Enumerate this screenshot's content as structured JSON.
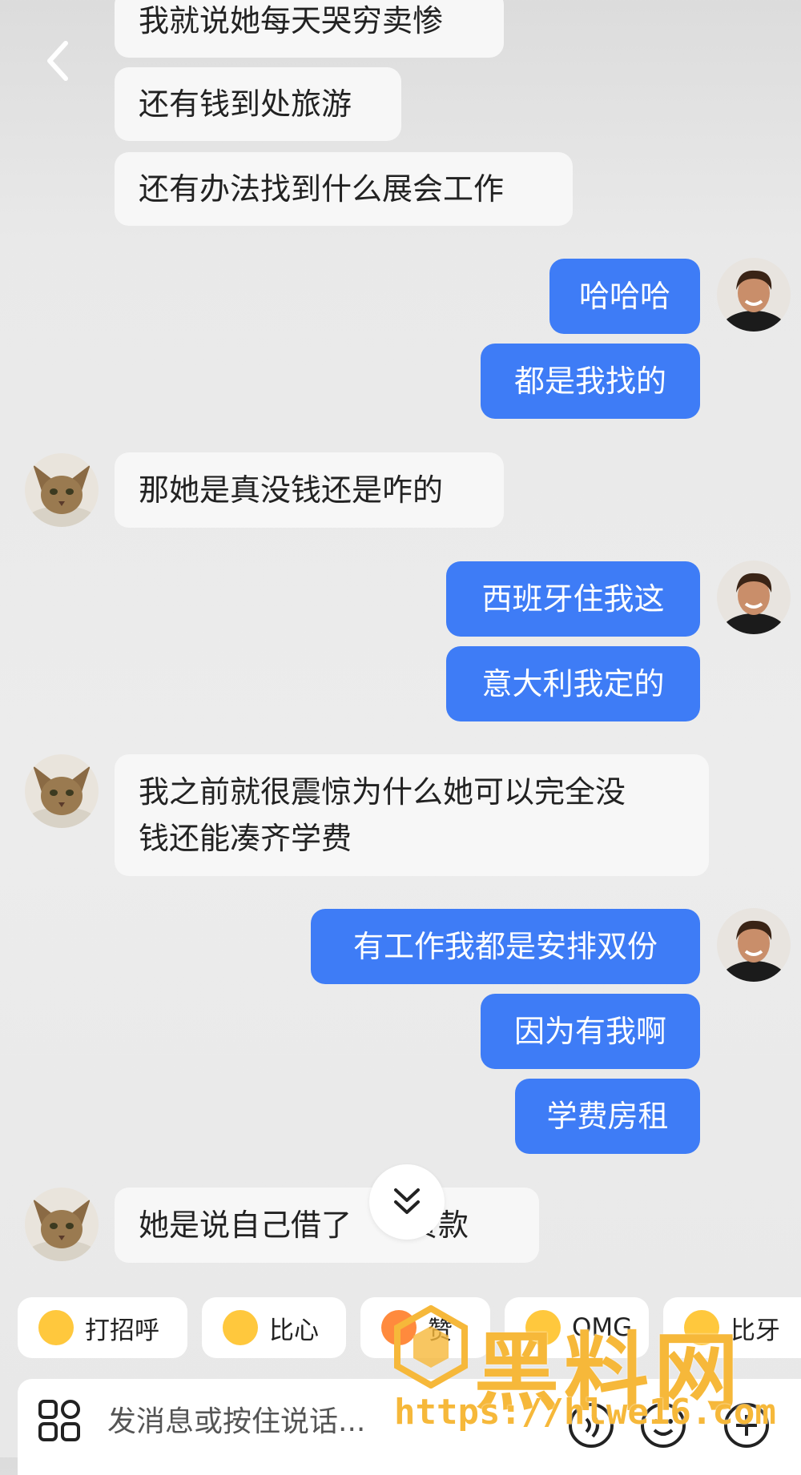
{
  "messages": [
    {
      "side": "left",
      "text": "我就说她每天哭穷卖惨"
    },
    {
      "side": "left",
      "text": "还有钱到处旅游"
    },
    {
      "side": "left",
      "text": "还有办法找到什么展会工作"
    },
    {
      "side": "right",
      "text": "哈哈哈"
    },
    {
      "side": "right",
      "text": "都是我找的"
    },
    {
      "side": "left",
      "text": "那她是真没钱还是咋的"
    },
    {
      "side": "right",
      "text": "西班牙住我这"
    },
    {
      "side": "right",
      "text": "意大利我定的"
    },
    {
      "side": "left",
      "line1": "我之前就很震惊为什么她可以完全没",
      "line2": "钱还能凑齐学费"
    },
    {
      "side": "right",
      "text": "有工作我都是安排双份"
    },
    {
      "side": "right",
      "text": "因为有我啊"
    },
    {
      "side": "right",
      "text": "学费房租"
    },
    {
      "side": "left",
      "text": "她是说自己借了",
      "text_after": "贷款"
    }
  ],
  "quick_replies": [
    {
      "label": "打招呼",
      "icon": "smiling-emoji-icon"
    },
    {
      "label": "比心",
      "icon": "heart-hands-emoji-icon"
    },
    {
      "label": "赞",
      "icon": "thumbs-up-emoji-icon"
    },
    {
      "label": "OMG",
      "icon": "omg-emoji-icon"
    },
    {
      "label": "比牙",
      "icon": "grin-emoji-icon"
    }
  ],
  "input": {
    "placeholder": "发消息或按住说话..."
  },
  "watermark": {
    "title": "黑料网",
    "url": "https://hlwe16.com"
  },
  "colors": {
    "sent_bubble": "#3e7cf6",
    "received_bubble": "#f7f7f7",
    "watermark": "#f6b83a"
  }
}
